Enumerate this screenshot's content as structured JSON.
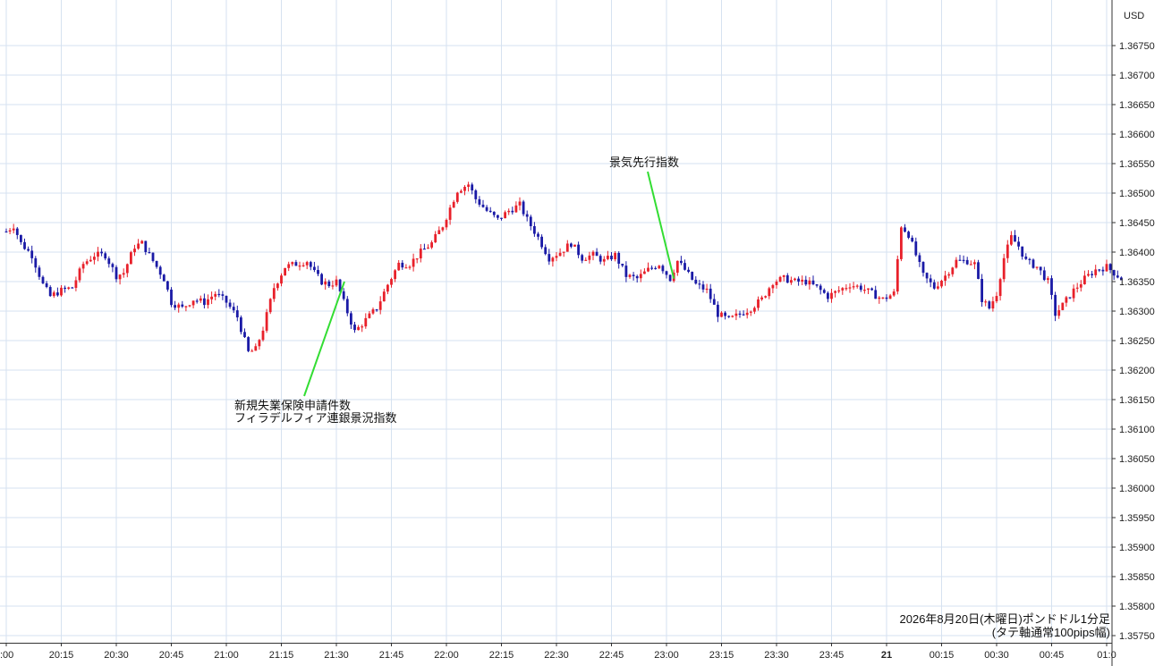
{
  "chart_data": {
    "type": "candlestick",
    "currency_label": "USD",
    "y_ticks": [
      "1.36750",
      "1.36700",
      "1.36650",
      "1.36600",
      "1.36550",
      "1.36500",
      "1.36450",
      "1.36400",
      "1.36350",
      "1.36300",
      "1.36250",
      "1.36200",
      "1.36150",
      "1.36100",
      "1.36050",
      "1.36000",
      "1.35950",
      "1.35900",
      "1.35850",
      "1.35800",
      "1.35750"
    ],
    "ylim": [
      1.35745,
      1.3677
    ],
    "x_ticks": [
      {
        "label": ":00",
        "t": 0,
        "bold": false
      },
      {
        "label": "20:15",
        "t": 15,
        "bold": false
      },
      {
        "label": "20:30",
        "t": 30,
        "bold": false
      },
      {
        "label": "20:45",
        "t": 45,
        "bold": false
      },
      {
        "label": "21:00",
        "t": 60,
        "bold": false
      },
      {
        "label": "21:15",
        "t": 75,
        "bold": false
      },
      {
        "label": "21:30",
        "t": 90,
        "bold": false
      },
      {
        "label": "21:45",
        "t": 105,
        "bold": false
      },
      {
        "label": "22:00",
        "t": 120,
        "bold": false
      },
      {
        "label": "22:15",
        "t": 135,
        "bold": false
      },
      {
        "label": "22:30",
        "t": 150,
        "bold": false
      },
      {
        "label": "22:45",
        "t": 165,
        "bold": false
      },
      {
        "label": "23:00",
        "t": 180,
        "bold": false
      },
      {
        "label": "23:15",
        "t": 195,
        "bold": false
      },
      {
        "label": "23:30",
        "t": 210,
        "bold": false
      },
      {
        "label": "23:45",
        "t": 225,
        "bold": false
      },
      {
        "label": "21",
        "t": 240,
        "bold": true
      },
      {
        "label": "00:15",
        "t": 255,
        "bold": false
      },
      {
        "label": "00:30",
        "t": 270,
        "bold": false
      },
      {
        "label": "00:45",
        "t": 285,
        "bold": false
      },
      {
        "label": "01:0",
        "t": 300,
        "bold": false
      }
    ],
    "up_color": "#e8202a",
    "down_color": "#1a1aa6",
    "path_points": [
      [
        0,
        1.36435
      ],
      [
        2,
        1.36445
      ],
      [
        4,
        1.36415
      ],
      [
        7,
        1.36395
      ],
      [
        10,
        1.36345
      ],
      [
        12,
        1.36325
      ],
      [
        15,
        1.36335
      ],
      [
        18,
        1.3634
      ],
      [
        21,
        1.3638
      ],
      [
        24,
        1.36395
      ],
      [
        27,
        1.36395
      ],
      [
        30,
        1.3636
      ],
      [
        32,
        1.36365
      ],
      [
        35,
        1.3641
      ],
      [
        37,
        1.36415
      ],
      [
        40,
        1.36385
      ],
      [
        43,
        1.36355
      ],
      [
        45,
        1.36315
      ],
      [
        48,
        1.36305
      ],
      [
        51,
        1.3632
      ],
      [
        54,
        1.36315
      ],
      [
        57,
        1.3633
      ],
      [
        60,
        1.36315
      ],
      [
        63,
        1.3629
      ],
      [
        66,
        1.3623
      ],
      [
        68,
        1.36235
      ],
      [
        70,
        1.3627
      ],
      [
        73,
        1.3634
      ],
      [
        76,
        1.36375
      ],
      [
        79,
        1.3638
      ],
      [
        82,
        1.36385
      ],
      [
        84,
        1.36365
      ],
      [
        86,
        1.3635
      ],
      [
        88,
        1.36345
      ],
      [
        90,
        1.3635
      ],
      [
        92,
        1.36315
      ],
      [
        95,
        1.36265
      ],
      [
        98,
        1.36285
      ],
      [
        101,
        1.36305
      ],
      [
        104,
        1.36345
      ],
      [
        107,
        1.3638
      ],
      [
        110,
        1.3638
      ],
      [
        113,
        1.364
      ],
      [
        116,
        1.36415
      ],
      [
        119,
        1.36445
      ],
      [
        121,
        1.36475
      ],
      [
        123,
        1.36505
      ],
      [
        126,
        1.36515
      ],
      [
        128,
        1.3649
      ],
      [
        131,
        1.3647
      ],
      [
        134,
        1.36455
      ],
      [
        137,
        1.3647
      ],
      [
        140,
        1.3648
      ],
      [
        142,
        1.36455
      ],
      [
        145,
        1.36425
      ],
      [
        148,
        1.3639
      ],
      [
        151,
        1.364
      ],
      [
        154,
        1.36415
      ],
      [
        157,
        1.3639
      ],
      [
        160,
        1.36395
      ],
      [
        163,
        1.36385
      ],
      [
        166,
        1.36395
      ],
      [
        169,
        1.3636
      ],
      [
        172,
        1.36355
      ],
      [
        175,
        1.3637
      ],
      [
        178,
        1.3638
      ],
      [
        181,
        1.36355
      ],
      [
        183,
        1.36385
      ],
      [
        185,
        1.3637
      ],
      [
        188,
        1.36345
      ],
      [
        191,
        1.36335
      ],
      [
        194,
        1.36295
      ],
      [
        197,
        1.36285
      ],
      [
        200,
        1.36295
      ],
      [
        203,
        1.36305
      ],
      [
        206,
        1.3632
      ],
      [
        209,
        1.3635
      ],
      [
        212,
        1.36355
      ],
      [
        215,
        1.3635
      ],
      [
        218,
        1.3635
      ],
      [
        221,
        1.3634
      ],
      [
        224,
        1.36325
      ],
      [
        227,
        1.36335
      ],
      [
        230,
        1.36345
      ],
      [
        233,
        1.3634
      ],
      [
        236,
        1.3633
      ],
      [
        239,
        1.3632
      ],
      [
        242,
        1.3633
      ],
      [
        244,
        1.36445
      ],
      [
        246,
        1.3643
      ],
      [
        248,
        1.36395
      ],
      [
        250,
        1.3636
      ],
      [
        253,
        1.3634
      ],
      [
        256,
        1.3636
      ],
      [
        259,
        1.36385
      ],
      [
        262,
        1.36385
      ],
      [
        264,
        1.3638
      ],
      [
        266,
        1.3632
      ],
      [
        268,
        1.36305
      ],
      [
        270,
        1.3633
      ],
      [
        272,
        1.3639
      ],
      [
        274,
        1.36425
      ],
      [
        276,
        1.3641
      ],
      [
        278,
        1.36385
      ],
      [
        281,
        1.36375
      ],
      [
        284,
        1.3635
      ],
      [
        286,
        1.36295
      ],
      [
        288,
        1.3631
      ],
      [
        291,
        1.36335
      ],
      [
        294,
        1.36355
      ],
      [
        297,
        1.3637
      ],
      [
        300,
        1.36375
      ],
      [
        303,
        1.3636
      ],
      [
        304,
        1.36355
      ]
    ],
    "annotations": [
      {
        "lines": [
          "新規失業保険申請件数",
          "フィラデルフィア連銀景況指数"
        ],
        "t": 90,
        "price": 1.3635
      },
      {
        "lines": [
          "景気先行指数"
        ],
        "t": 182,
        "price": 1.36355
      }
    ],
    "footer_lines": [
      "2026年8月20日(木曜日)ポンドドル1分足",
      "(タテ軸通常100pips幅)"
    ]
  }
}
